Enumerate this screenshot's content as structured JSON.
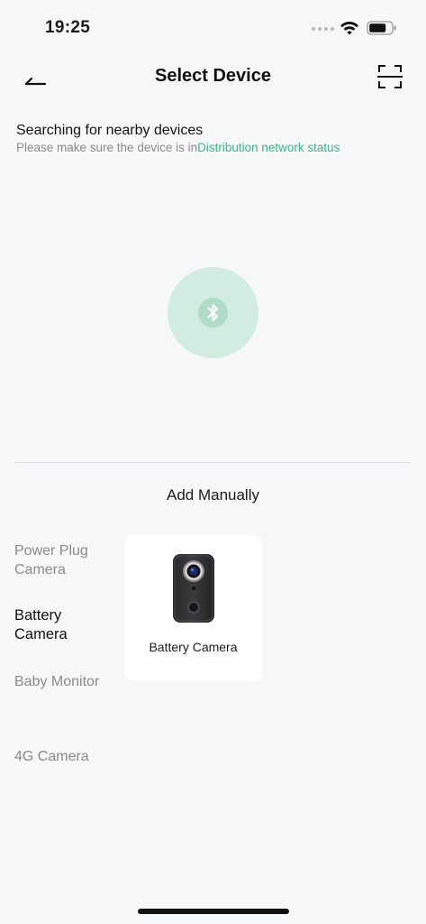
{
  "status_bar": {
    "time": "19:25"
  },
  "nav": {
    "title": "Select Device"
  },
  "search": {
    "title": "Searching for nearby devices",
    "subtitle_prefix": "Please make sure the device is in",
    "subtitle_link": "Distribution network status"
  },
  "manual": {
    "title": "Add Manually"
  },
  "categories": [
    {
      "label": "Power Plug Camera",
      "active": false
    },
    {
      "label": "Battery Camera",
      "active": true
    },
    {
      "label": "Baby Monitor",
      "active": false
    },
    {
      "label": "4G Camera",
      "active": false
    }
  ],
  "devices": [
    {
      "label": "Battery Camera",
      "icon": "battery-camera-image"
    }
  ],
  "colors": {
    "accent": "#3bb583",
    "bluetooth_halo": "#d3ece1",
    "background": "#f6f7f9"
  }
}
